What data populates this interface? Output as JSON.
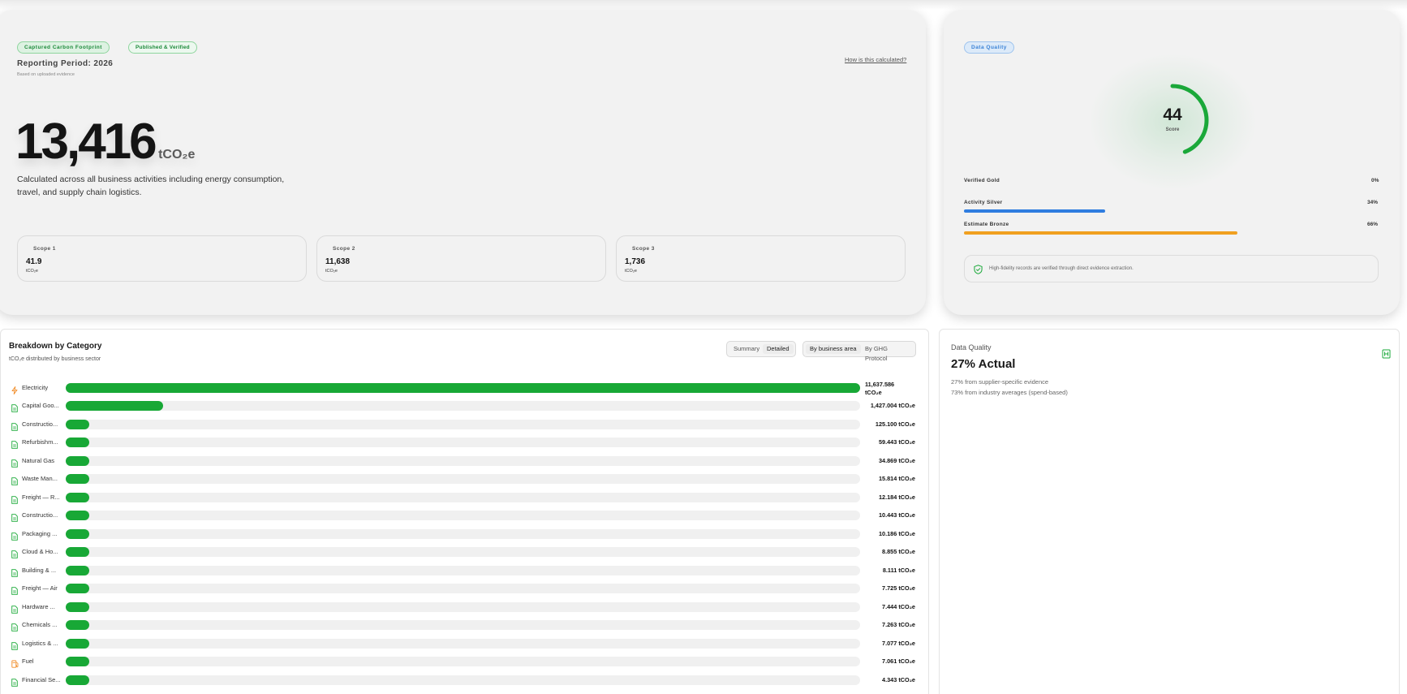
{
  "hero": {
    "badge_footprint": "Captured Carbon Footprint",
    "badge_status": "Published & Verified",
    "reporting_period": "Reporting Period: 2026",
    "basis": "Based on uploaded evidence",
    "help_link": "How is this calculated?",
    "total": "13,416",
    "total_unit": "tCO₂e",
    "description": "Calculated across all business activities including energy consumption, travel, and supply chain logistics.",
    "scopes": [
      {
        "label": "Scope 1",
        "value": "41.9",
        "unit": "tCO₂e"
      },
      {
        "label": "Scope 2",
        "value": "11,638",
        "unit": "tCO₂e"
      },
      {
        "label": "Scope 3",
        "value": "1,736",
        "unit": "tCO₂e"
      }
    ]
  },
  "data_quality": {
    "badge": "Data Quality",
    "score": "44",
    "score_label": "Score",
    "score_fraction": 0.44,
    "tiers": [
      {
        "label": "Verified Gold",
        "pct": "0%",
        "fraction": 0.0,
        "color": "#e0b23a"
      },
      {
        "label": "Activity Silver",
        "pct": "34%",
        "fraction": 0.34,
        "color": "#2f7de0"
      },
      {
        "label": "Estimate Bronze",
        "pct": "66%",
        "fraction": 0.66,
        "color": "#f0a020"
      }
    ],
    "note": "High-fidelity records are verified through direct evidence extraction."
  },
  "breakdown": {
    "title": "Breakdown by Category",
    "subtitle": "tCO₂e distributed by business sector",
    "view_toggle": {
      "summary": "Summary",
      "detailed": "Detailed"
    },
    "group_toggle": {
      "area": "By business area",
      "ghg": "By GHG Protocol"
    },
    "accent": "#18a836",
    "rows": [
      {
        "label": "Electricity",
        "value": "11,637.586 tCO₂e",
        "amount": 11637.586,
        "icon": "bolt-icon",
        "icon_color": "#f08a24"
      },
      {
        "label": "Capital Goo...",
        "value": "1,427.004 tCO₂e",
        "amount": 1427.004,
        "icon": "document-icon",
        "icon_color": "#18a836"
      },
      {
        "label": "Constructio...",
        "value": "125.100 tCO₂e",
        "amount": 125.1,
        "icon": "document-icon",
        "icon_color": "#18a836"
      },
      {
        "label": "Refurbishm...",
        "value": "59.443 tCO₂e",
        "amount": 59.443,
        "icon": "document-icon",
        "icon_color": "#18a836"
      },
      {
        "label": "Natural Gas",
        "value": "34.869 tCO₂e",
        "amount": 34.869,
        "icon": "document-icon",
        "icon_color": "#18a836"
      },
      {
        "label": "Waste Man...",
        "value": "15.814 tCO₂e",
        "amount": 15.814,
        "icon": "document-icon",
        "icon_color": "#18a836"
      },
      {
        "label": "Freight — R...",
        "value": "12.184 tCO₂e",
        "amount": 12.184,
        "icon": "document-icon",
        "icon_color": "#18a836"
      },
      {
        "label": "Constructio...",
        "value": "10.443 tCO₂e",
        "amount": 10.443,
        "icon": "document-icon",
        "icon_color": "#18a836"
      },
      {
        "label": "Packaging ...",
        "value": "10.186 tCO₂e",
        "amount": 10.186,
        "icon": "document-icon",
        "icon_color": "#18a836"
      },
      {
        "label": "Cloud & Ho...",
        "value": "8.855 tCO₂e",
        "amount": 8.855,
        "icon": "document-icon",
        "icon_color": "#18a836"
      },
      {
        "label": "Building & ...",
        "value": "8.111 tCO₂e",
        "amount": 8.111,
        "icon": "document-icon",
        "icon_color": "#18a836"
      },
      {
        "label": "Freight — Air",
        "value": "7.725 tCO₂e",
        "amount": 7.725,
        "icon": "document-icon",
        "icon_color": "#18a836"
      },
      {
        "label": "Hardware ...",
        "value": "7.444 tCO₂e",
        "amount": 7.444,
        "icon": "document-icon",
        "icon_color": "#18a836"
      },
      {
        "label": "Chemicals ...",
        "value": "7.263 tCO₂e",
        "amount": 7.263,
        "icon": "document-icon",
        "icon_color": "#18a836"
      },
      {
        "label": "Logistics & ...",
        "value": "7.077 tCO₂e",
        "amount": 7.077,
        "icon": "document-icon",
        "icon_color": "#18a836"
      },
      {
        "label": "Fuel",
        "value": "7.061 tCO₂e",
        "amount": 7.061,
        "icon": "fuel-icon",
        "icon_color": "#f08a24"
      },
      {
        "label": "Financial Se...",
        "value": "4.343 tCO₂e",
        "amount": 4.343,
        "icon": "document-icon",
        "icon_color": "#18a836"
      }
    ]
  },
  "actual": {
    "label": "Data Quality",
    "headline": "27% Actual",
    "line1": "27% from supplier-specific evidence",
    "line2": "73% from industry averages (spend-based)"
  }
}
